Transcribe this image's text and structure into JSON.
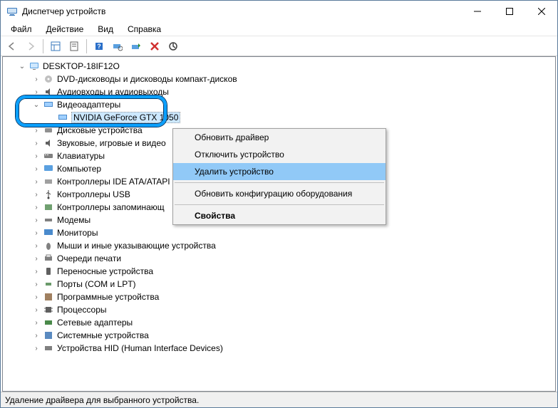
{
  "window": {
    "title": "Диспетчер устройств",
    "minimize": "—",
    "maximize": "□",
    "close": "✕"
  },
  "menu": {
    "file": "Файл",
    "action": "Действие",
    "view": "Вид",
    "help": "Справка"
  },
  "tree": {
    "root": "DESKTOP-18IF12O",
    "items": [
      "DVD-дисководы и дисководы компакт-дисков",
      "Аудиовходы и аудиовыходы",
      "Видеоадаптеры",
      "Дисковые устройства",
      "Звуковые, игровые и видео",
      "Клавиатуры",
      "Компьютер",
      "Контроллеры IDE ATA/ATAPI",
      "Контроллеры USB",
      "Контроллеры запоминающ",
      "Модемы",
      "Мониторы",
      "Мыши и иные указывающие устройства",
      "Очереди печати",
      "Переносные устройства",
      "Порты (COM и LPT)",
      "Программные устройства",
      "Процессоры",
      "Сетевые адаптеры",
      "Системные устройства",
      "Устройства HID (Human Interface Devices)"
    ],
    "gpu": "NVIDIA GeForce GTX 1050"
  },
  "contextMenu": {
    "update": "Обновить драйвер",
    "disable": "Отключить устройство",
    "remove": "Удалить устройство",
    "rescan": "Обновить конфигурацию оборудования",
    "props": "Свойства"
  },
  "status": "Удаление драйвера для выбранного устройства."
}
